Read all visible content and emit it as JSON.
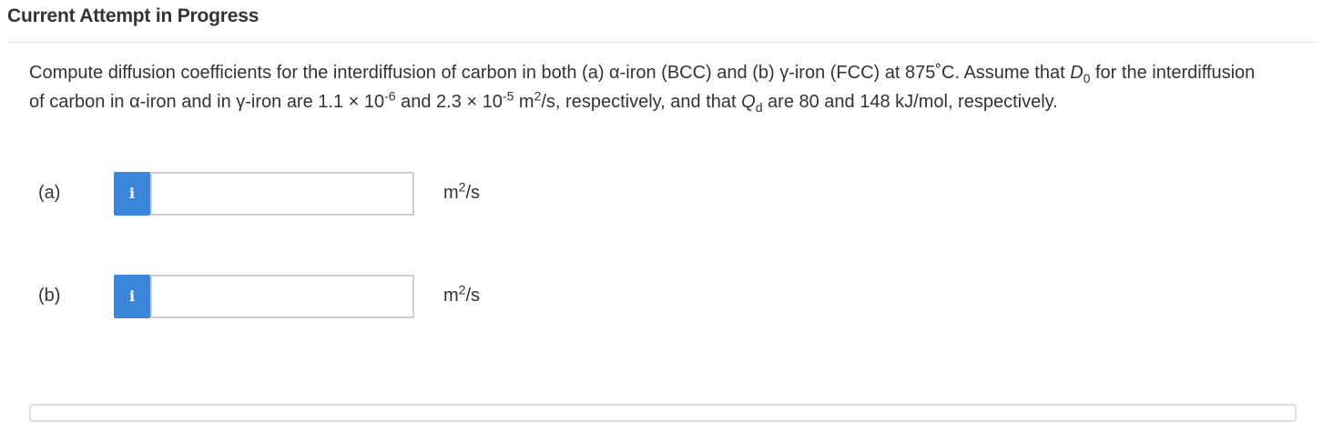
{
  "header": {
    "title": "Current Attempt in Progress"
  },
  "question": {
    "s1": "Compute diffusion coefficients for the interdiffusion of carbon in both (a) α-iron (BCC) and (b) γ-iron (FCC) at 875˚C. Assume that ",
    "d0_symbol": "D",
    "d0_sub": "0",
    "s2": " for the interdiffusion of carbon in α-iron and in γ-iron are 1.1 × 10",
    "exp1": "-6",
    "s3": " and 2.3 × 10",
    "exp2": "-5",
    "s4": " m",
    "exp3": "2",
    "s5": "/s, respectively, and that ",
    "qd_symbol": "Q",
    "qd_sub": "d",
    "s6": " are 80 and 148 kJ/mol, respectively."
  },
  "answers": [
    {
      "label": "(a)",
      "info_icon": "i",
      "value": "",
      "unit_base": "m",
      "unit_exp": "2",
      "unit_tail": "/s"
    },
    {
      "label": "(b)",
      "info_icon": "i",
      "value": "",
      "unit_base": "m",
      "unit_exp": "2",
      "unit_tail": "/s"
    }
  ],
  "colors": {
    "info_button": "#3b86d9",
    "text": "#333333",
    "input_border": "#cfcfcf"
  }
}
